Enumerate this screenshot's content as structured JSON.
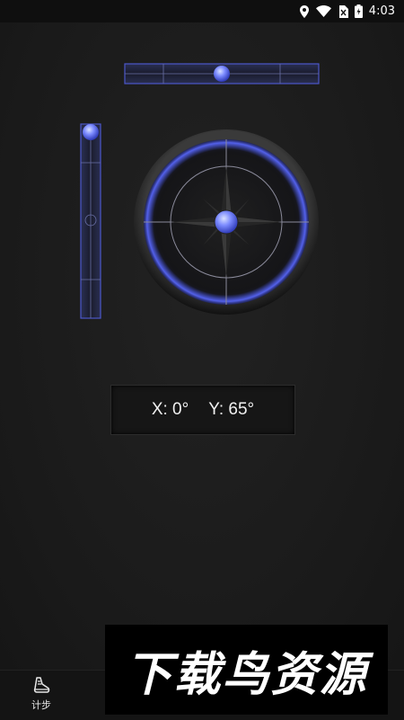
{
  "status_bar": {
    "time": "4:03",
    "icons": [
      "location-icon",
      "wifi-icon",
      "no-sim-icon",
      "battery-charging-icon"
    ]
  },
  "level": {
    "horizontal_bubble_fraction": 0.5,
    "vertical_bubble_fraction": 0.0,
    "accent_color": "#5b6cff"
  },
  "readout": {
    "x_text": "X: 0°",
    "y_text": "Y: 65°"
  },
  "bottom_nav": {
    "items": [
      {
        "label": "计步",
        "icon": "shoe-icon"
      }
    ]
  },
  "watermark": {
    "text": "下载鸟资源"
  }
}
